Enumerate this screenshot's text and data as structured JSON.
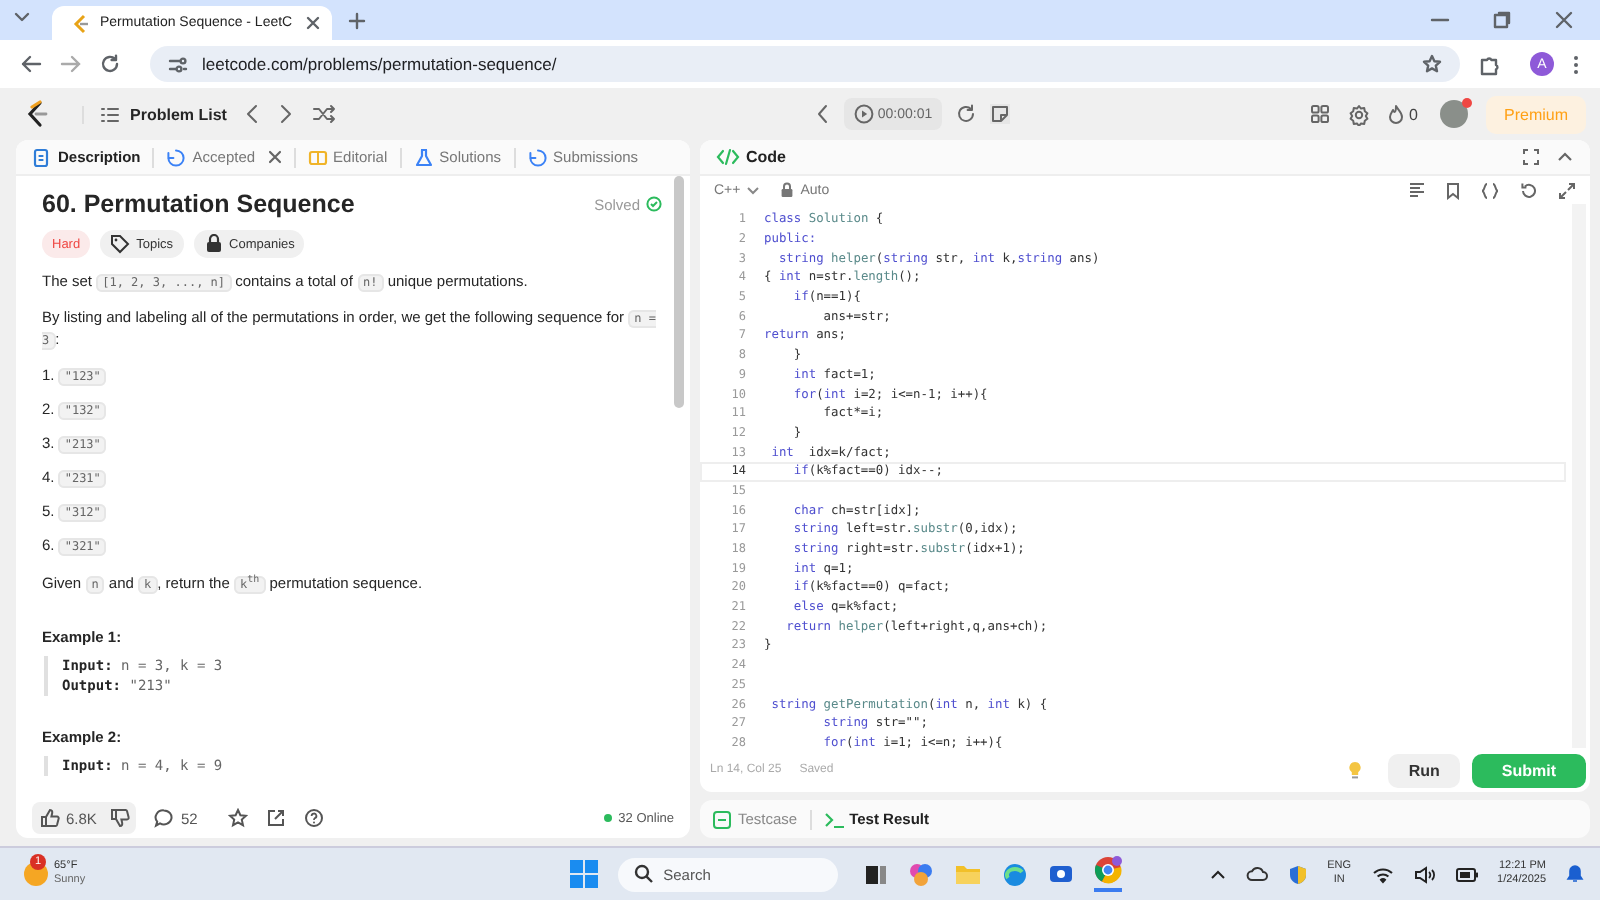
{
  "browser": {
    "tab_title": "Permutation Sequence - LeetC",
    "url": "leetcode.com/problems/permutation-sequence/",
    "profile_initial": "A"
  },
  "nav": {
    "problem_list": "Problem List",
    "timer": "00:00:01",
    "streak": "0",
    "premium": "Premium"
  },
  "description_tabs": [
    {
      "label": "Description",
      "kind": "description",
      "selected": true,
      "closable": false
    },
    {
      "label": "Accepted",
      "kind": "accepted",
      "selected": false,
      "closable": true
    },
    {
      "label": "Editorial",
      "kind": "editorial",
      "selected": false,
      "closable": false
    },
    {
      "label": "Solutions",
      "kind": "solutions",
      "selected": false,
      "closable": false
    },
    {
      "label": "Submissions",
      "kind": "submissions",
      "selected": false,
      "closable": false
    }
  ],
  "problem": {
    "title": "60. Permutation Sequence",
    "status": "Solved",
    "difficulty": "Hard",
    "tags": [
      {
        "label": "Topics",
        "kind": "topics"
      },
      {
        "label": "Companies",
        "kind": "companies"
      }
    ],
    "paragraphs": [
      [
        {
          "text": "The set ",
          "kind": "text"
        },
        {
          "text": "[1, 2, 3, ..., n]",
          "kind": "code"
        },
        {
          "text": " contains a total of ",
          "kind": "text"
        },
        {
          "text": "n!",
          "kind": "code"
        },
        {
          "text": " unique permutations.",
          "kind": "text"
        }
      ],
      [
        {
          "text": "By listing and labeling all of the permutations in order, we get the following sequence for ",
          "kind": "text"
        },
        {
          "text": "n = 3",
          "kind": "code"
        },
        {
          "text": ":",
          "kind": "text"
        }
      ]
    ],
    "sequence": [
      {
        "number": "1.",
        "value": "\"123\""
      },
      {
        "number": "2.",
        "value": "\"132\""
      },
      {
        "number": "3.",
        "value": "\"213\""
      },
      {
        "number": "4.",
        "value": "\"231\""
      },
      {
        "number": "5.",
        "value": "\"312\""
      },
      {
        "number": "6.",
        "value": "\"321\""
      }
    ],
    "closing": [
      {
        "text": "Given ",
        "kind": "text"
      },
      {
        "text": "n",
        "kind": "code"
      },
      {
        "text": " and ",
        "kind": "text"
      },
      {
        "text": "k",
        "kind": "code"
      },
      {
        "text": ", return the ",
        "kind": "text"
      },
      {
        "text": "k$^{th}$",
        "kind": "code"
      },
      {
        "text": " permutation sequence.",
        "kind": "text"
      }
    ],
    "examples": [
      {
        "title": "Example 1:",
        "lines": [
          {
            "label": "Input:",
            "value": "n = 3, k = 3"
          },
          {
            "label": "Output:",
            "value": "\"213\""
          }
        ]
      },
      {
        "title": "Example 2:",
        "lines": [
          {
            "label": "Input:",
            "value": "n = 4, k = 9"
          }
        ]
      }
    ]
  },
  "description_footer": {
    "likes": "6.8K",
    "comments": "52",
    "online": "32 Online"
  },
  "editor": {
    "title": "Code",
    "language": "C++",
    "mode": "Auto",
    "position": "Ln 14, Col 25",
    "save_state": "Saved",
    "run": "Run",
    "submit": "Submit",
    "lines": [
      {
        "number": "1",
        "current": false,
        "segments": [
          {
            "text": "class",
            "kind": "keyword"
          },
          {
            "text": " Solution",
            "kind": "name"
          },
          {
            "text": " {",
            "kind": "plain"
          }
        ]
      },
      {
        "number": "2",
        "current": false,
        "segments": [
          {
            "text": "public:",
            "kind": "keyword"
          }
        ]
      },
      {
        "number": "3",
        "current": false,
        "segments": [
          {
            "text": "  string",
            "kind": "keyword"
          },
          {
            "text": " helper",
            "kind": "name"
          },
          {
            "text": "(",
            "kind": "plain"
          },
          {
            "text": "string",
            "kind": "keyword"
          },
          {
            "text": " str, ",
            "kind": "plain"
          },
          {
            "text": "int",
            "kind": "keyword"
          },
          {
            "text": " k,",
            "kind": "plain"
          },
          {
            "text": "string",
            "kind": "keyword"
          },
          {
            "text": " ans)",
            "kind": "plain"
          }
        ]
      },
      {
        "number": "4",
        "current": false,
        "segments": [
          {
            "text": "{ ",
            "kind": "plain"
          },
          {
            "text": "int",
            "kind": "keyword"
          },
          {
            "text": " n=str.",
            "kind": "plain"
          },
          {
            "text": "length",
            "kind": "name"
          },
          {
            "text": "();",
            "kind": "plain"
          }
        ]
      },
      {
        "number": "5",
        "current": false,
        "segments": [
          {
            "text": "    if",
            "kind": "keyword"
          },
          {
            "text": "(n==1){",
            "kind": "plain"
          }
        ]
      },
      {
        "number": "6",
        "current": false,
        "segments": [
          {
            "text": "        ans+=str;",
            "kind": "plain"
          }
        ]
      },
      {
        "number": "7",
        "current": false,
        "segments": [
          {
            "text": "return",
            "kind": "keyword"
          },
          {
            "text": " ans;",
            "kind": "plain"
          }
        ]
      },
      {
        "number": "8",
        "current": false,
        "segments": [
          {
            "text": "    }",
            "kind": "plain"
          }
        ]
      },
      {
        "number": "9",
        "current": false,
        "segments": [
          {
            "text": "    int",
            "kind": "keyword"
          },
          {
            "text": " fact=1;",
            "kind": "plain"
          }
        ]
      },
      {
        "number": "10",
        "current": false,
        "segments": [
          {
            "text": "    for",
            "kind": "keyword"
          },
          {
            "text": "(",
            "kind": "plain"
          },
          {
            "text": "int",
            "kind": "keyword"
          },
          {
            "text": " i=2; i<=n-1; i++){",
            "kind": "plain"
          }
        ]
      },
      {
        "number": "11",
        "current": false,
        "segments": [
          {
            "text": "        fact*=i;",
            "kind": "plain"
          }
        ]
      },
      {
        "number": "12",
        "current": false,
        "segments": [
          {
            "text": "    }",
            "kind": "plain"
          }
        ]
      },
      {
        "number": "13",
        "current": false,
        "segments": [
          {
            "text": " int",
            "kind": "keyword"
          },
          {
            "text": "  idx=k/fact;",
            "kind": "plain"
          }
        ]
      },
      {
        "number": "14",
        "current": true,
        "segments": [
          {
            "text": "    if",
            "kind": "keyword"
          },
          {
            "text": "(k%fact==0) idx--;",
            "kind": "plain"
          }
        ]
      },
      {
        "number": "15",
        "current": false
      },
      {
        "number": "16",
        "current": false,
        "segments": [
          {
            "text": "    char",
            "kind": "keyword"
          },
          {
            "text": " ch=str[idx];",
            "kind": "plain"
          }
        ]
      },
      {
        "number": "17",
        "current": false,
        "segments": [
          {
            "text": "    string",
            "kind": "keyword"
          },
          {
            "text": " left=str.",
            "kind": "plain"
          },
          {
            "text": "substr",
            "kind": "name"
          },
          {
            "text": "(0,idx);",
            "kind": "plain"
          }
        ]
      },
      {
        "number": "18",
        "current": false,
        "segments": [
          {
            "text": "    string",
            "kind": "keyword"
          },
          {
            "text": " right=str.",
            "kind": "plain"
          },
          {
            "text": "substr",
            "kind": "name"
          },
          {
            "text": "(idx+1);",
            "kind": "plain"
          }
        ]
      },
      {
        "number": "19",
        "current": false,
        "segments": [
          {
            "text": "    int",
            "kind": "keyword"
          },
          {
            "text": " q=1;",
            "kind": "plain"
          }
        ]
      },
      {
        "number": "20",
        "current": false,
        "segments": [
          {
            "text": "    if",
            "kind": "keyword"
          },
          {
            "text": "(k%fact==0) q=fact;",
            "kind": "plain"
          }
        ]
      },
      {
        "number": "21",
        "current": false,
        "segments": [
          {
            "text": "    else",
            "kind": "keyword"
          },
          {
            "text": " q=k%fact;",
            "kind": "plain"
          }
        ]
      },
      {
        "number": "22",
        "current": false,
        "segments": [
          {
            "text": "   return",
            "kind": "keyword"
          },
          {
            "text": " helper",
            "kind": "name"
          },
          {
            "text": "(left+right,q,ans+ch);",
            "kind": "plain"
          }
        ]
      },
      {
        "number": "23",
        "current": false,
        "segments": [
          {
            "text": "}",
            "kind": "plain"
          }
        ]
      },
      {
        "number": "24",
        "current": false
      },
      {
        "number": "25",
        "current": false
      },
      {
        "number": "26",
        "current": false,
        "segments": [
          {
            "text": " string",
            "kind": "keyword"
          },
          {
            "text": " getPermutation",
            "kind": "name"
          },
          {
            "text": "(",
            "kind": "plain"
          },
          {
            "text": "int",
            "kind": "keyword"
          },
          {
            "text": " n, ",
            "kind": "plain"
          },
          {
            "text": "int",
            "kind": "keyword"
          },
          {
            "text": " k) {",
            "kind": "plain"
          }
        ]
      },
      {
        "number": "27",
        "current": false,
        "segments": [
          {
            "text": "        string",
            "kind": "keyword"
          },
          {
            "text": " str=\"\";",
            "kind": "plain"
          }
        ]
      },
      {
        "number": "28",
        "current": false,
        "segments": [
          {
            "text": "        for",
            "kind": "keyword"
          },
          {
            "text": "(",
            "kind": "plain"
          },
          {
            "text": "int",
            "kind": "keyword"
          },
          {
            "text": " i=1; i<=n; i++){",
            "kind": "plain"
          }
        ]
      }
    ]
  },
  "bottom_tabs": [
    {
      "label": "Testcase",
      "kind": "testcase",
      "selected": false
    },
    {
      "label": "Test Result",
      "kind": "result",
      "selected": true
    }
  ],
  "taskbar": {
    "weather_alert": "1",
    "temperature": "65°F",
    "condition": "Sunny",
    "search_placeholder": "Search",
    "language": "ENG",
    "region": "IN",
    "time": "12:21 PM",
    "date": "1/24/2025"
  }
}
